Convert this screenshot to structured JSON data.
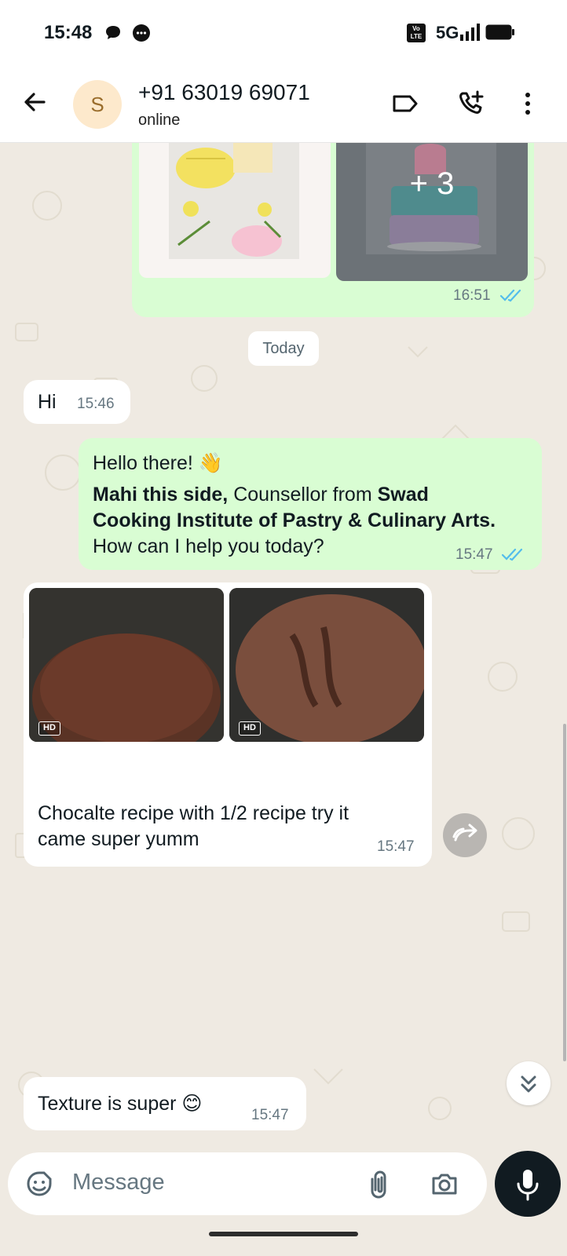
{
  "status_bar": {
    "time": "15:48",
    "network": "5G",
    "volte": "Vo LTE"
  },
  "header": {
    "avatar_letter": "S",
    "contact_name": "+91 63019 69071",
    "contact_status": "online"
  },
  "chat": {
    "gallery_message": {
      "more_count": "+ 3",
      "time": "16:51"
    },
    "date_divider": "Today",
    "messages": [
      {
        "direction": "in",
        "text": "Hi",
        "time": "15:46"
      },
      {
        "direction": "out",
        "greeting": "Hello there! 👋",
        "bold_1": "Mahi this side,",
        "plain_1": " Counsellor from ",
        "bold_2": "Swad",
        "bold_3": "Cooking Institute of Pastry & Culinary Arts.",
        "line_3": "How can I help you today?",
        "time": "15:47"
      },
      {
        "direction": "in",
        "hd_label": "HD",
        "caption_line_1": "Chocalte recipe with 1/2 recipe try it",
        "caption_line_2": "came super yumm",
        "time": "15:47"
      },
      {
        "direction": "in",
        "text": "Texture is super 😊",
        "time": "15:47"
      }
    ]
  },
  "input": {
    "placeholder": "Message"
  },
  "colors": {
    "outgoing_bubble": "#d9fdd3",
    "incoming_bubble": "#ffffff",
    "wallpaper": "#efeae2",
    "read_ticks": "#53bdeb"
  },
  "icons": [
    "back-arrow-icon",
    "label-icon",
    "add-call-icon",
    "more-vert-icon",
    "sticker-icon",
    "attach-icon",
    "camera-icon",
    "mic-icon",
    "forward-icon",
    "double-chevron-down-icon"
  ]
}
